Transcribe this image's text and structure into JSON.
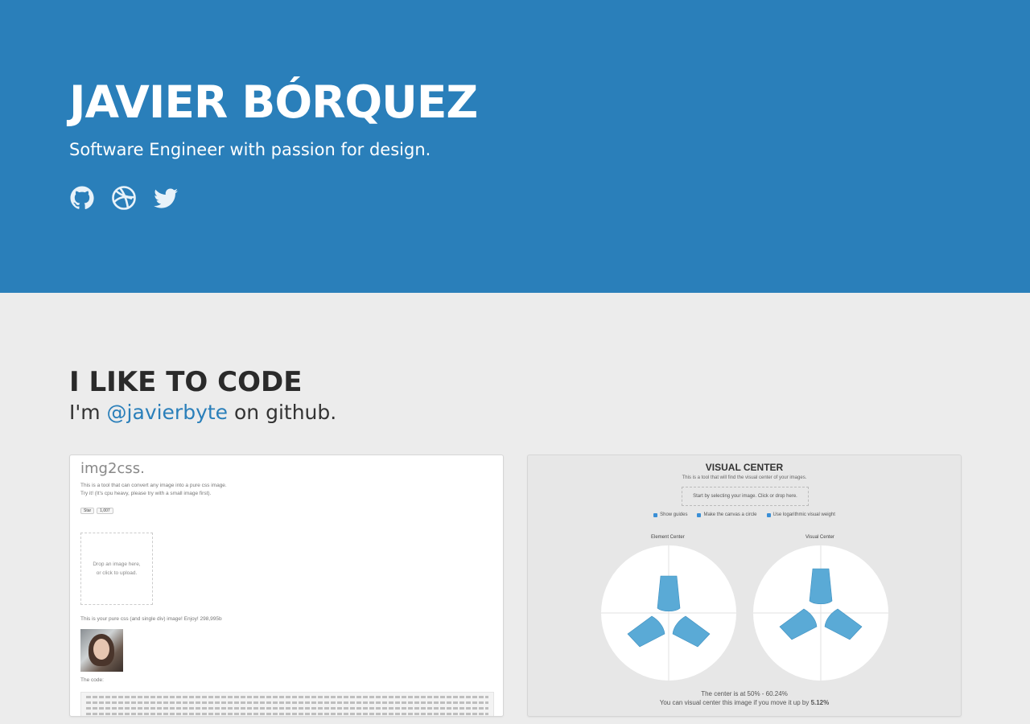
{
  "hero": {
    "name": "JAVIER BÓRQUEZ",
    "tagline": "Software Engineer with passion for design.",
    "social_icons": [
      "github-icon",
      "dribbble-icon",
      "twitter-icon"
    ],
    "bg_color": "#2a7fba"
  },
  "section": {
    "title": "I LIKE TO CODE",
    "sub_prefix": "I'm ",
    "sub_link": "@javierbyte",
    "sub_suffix": " on github.",
    "link_color": "#2a7fba"
  },
  "projects": [
    {
      "title": "img2css.",
      "desc1": "This is a tool that can convert any image into a pure css image.",
      "desc2": "Try it! (It's cpu heavy, please try with a small image first).",
      "star_label": "Star",
      "star_count": "1,007",
      "drop_line1": "Drop an image here,",
      "drop_line2": "or click to upload.",
      "result_text": "This is your pure css (and single div) image! Enjoy! 298,995b",
      "code_label": "The code:"
    },
    {
      "title": "VISUAL CENTER",
      "desc": "This is a tool that will find the visual center of your images.",
      "drop": "Start by selecting your image. Click or drop here.",
      "options": [
        "Show guides",
        "Make the canvas a circle",
        "Use logarithmic visual weight"
      ],
      "label_left": "Element Center",
      "label_right": "Visual Center",
      "foot1": "The center is at 50% - 60.24%",
      "foot2_prefix": "You can visual center this image if you move it up by ",
      "foot2_value": "5.12%"
    }
  ]
}
